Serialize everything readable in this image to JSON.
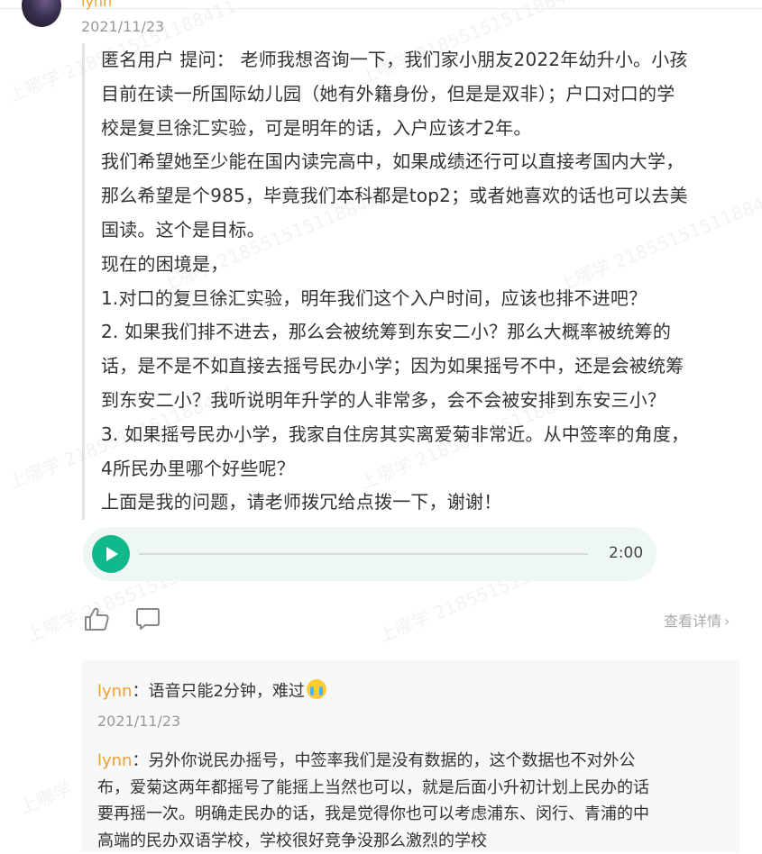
{
  "post": {
    "author": "lynn",
    "date": "2021/11/23",
    "question_lines": [
      "匿名用户  提问：  老师我想咨询一下，我们家小朋友2022年幼升小。小孩",
      "目前在读一所国际幼儿园（她有外籍身份，但是是双非）；户口对口的学",
      "校是复旦徐汇实验，可是明年的话，入户应该才2年。",
      "我们希望她至少能在国内读完高中，如果成绩还行可以直接考国内大学，",
      "那么希望是个985，毕竟我们本科都是top2；或者她喜欢的话也可以去美",
      "国读。这个是目标。",
      "现在的困境是，",
      "1.对口的复旦徐汇实验，明年我们这个入户时间，应该也排不进吧？",
      "2. 如果我们排不进去，那么会被统筹到东安二小？那么大概率被统筹的",
      "话，是不是不如直接去摇号民办小学；因为如果摇号不中，还是会被统筹",
      "到东安二小？我听说明年升学的人非常多，会不会被安排到东安三小？",
      "3. 如果摇号民办小学，我家自住房其实离爱菊非常近。从中签率的角度，",
      "4所民办里哪个好些呢？",
      "上面是我的问题，请老师拨冗给点拨一下，谢谢！"
    ]
  },
  "audio": {
    "duration": "2:00",
    "progress": 0
  },
  "actions": {
    "detail_label": "查看详情",
    "like_icon": "thumbs-up-icon",
    "comment_icon": "comment-icon"
  },
  "replies": [
    {
      "name": "lynn",
      "sep": "：",
      "text": "语音只能2分钟，难过",
      "emoji": "crying-face-emoji",
      "date": "2021/11/23"
    },
    {
      "name": "lynn",
      "sep": "：",
      "lines": [
        "另外你说民办摇号，中签率我们是没有数据的，这个数据也不对外公",
        "布，爱菊这两年都摇号了能摇上当然也可以，就是后面小升初计划上民办的话",
        "要再摇一次。明确走民办的话，我是觉得你也可以考虑浦东、闵行、青浦的中",
        "高端的民办双语学校，学校很好竞争没那么激烈的学校"
      ]
    }
  ],
  "watermark": {
    "text": "上哪学 2185515151188411",
    "short": "上哪学"
  }
}
